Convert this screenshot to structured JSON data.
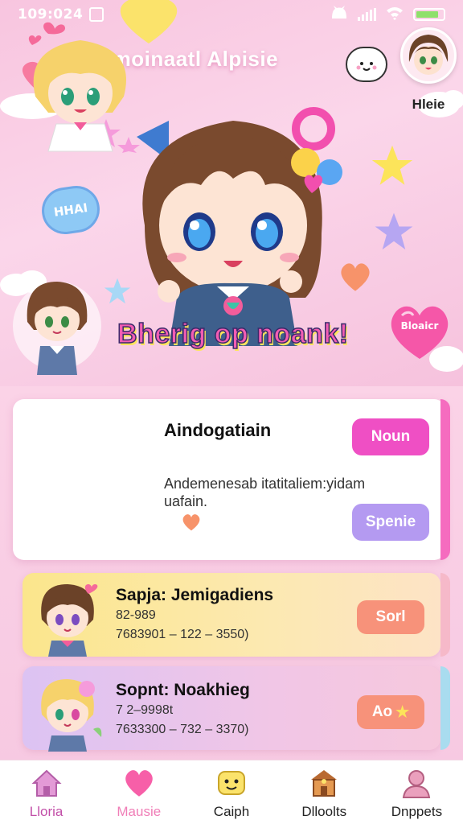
{
  "status_bar": {
    "time": "109:024",
    "battery_level": 0.85
  },
  "header": {
    "app_title": "Cpmoinaatl Alpisie",
    "profile_name": "Hleie",
    "cloud_icon": "cloud-face-icon"
  },
  "hero": {
    "speech_bubble": "HHAI",
    "banner": "Bherig op noank!",
    "heart_badge": "Bloaicr"
  },
  "main_card": {
    "title": "Aindogatiain",
    "description": "Andemenesab itatitaliem:yidam uafain.",
    "primary_button": "Noun",
    "secondary_button": "Spenie"
  },
  "rows": [
    {
      "title": "Sapja: Jemigadiens",
      "line1": "82-989",
      "line2": "7683901 – 122 – 3550)",
      "button": "Sorl"
    },
    {
      "title": "Sopnt: Noakhieg",
      "line1": "7 2–9998t",
      "line2": "7633300 – 732 – 3370)",
      "button": "Ao"
    }
  ],
  "nav": [
    {
      "label": "Lloria",
      "icon": "home-icon"
    },
    {
      "label": "Mausie",
      "icon": "heart-icon"
    },
    {
      "label": "Caiph",
      "icon": "chat-face-icon"
    },
    {
      "label": "Dlloolts",
      "icon": "shop-icon"
    },
    {
      "label": "Dnppets",
      "icon": "profile-icon"
    }
  ],
  "colors": {
    "accent_pink": "#ef4fc4",
    "accent_lilac": "#b49af1",
    "accent_coral": "#f7927a",
    "background": "#fbd7ea"
  }
}
